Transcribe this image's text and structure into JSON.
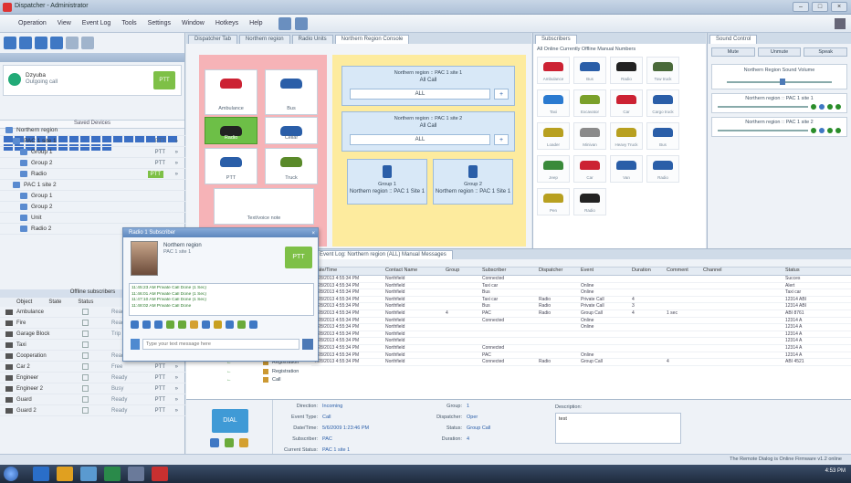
{
  "window": {
    "title": "Dispatcher - Administrator"
  },
  "menu": {
    "items": [
      "Operation",
      "View",
      "Event Log",
      "Tools",
      "Settings",
      "Window",
      "Hotkeys",
      "Help"
    ]
  },
  "left": {
    "account": {
      "name": "Dzyuba",
      "status": "Outgoing call",
      "ptt": "PTT"
    },
    "stub_label": "Saved Devices",
    "tree": [
      {
        "label": "Northern region",
        "level": 0,
        "ptt": "",
        "hi": false
      },
      {
        "label": "PAC 1 site 1",
        "level": 1,
        "ptt": "PTT",
        "hi": false
      },
      {
        "label": "Group 1",
        "level": 2,
        "ptt": "PTT",
        "hi": false
      },
      {
        "label": "Group 2",
        "level": 2,
        "ptt": "PTT",
        "hi": false
      },
      {
        "label": "Radio",
        "level": 2,
        "ptt": "PTT",
        "hi": true
      },
      {
        "label": "PAC 1 site 2",
        "level": 1,
        "ptt": "",
        "hi": false
      },
      {
        "label": "Group 1",
        "level": 2,
        "ptt": "",
        "hi": false
      },
      {
        "label": "Group 2",
        "level": 2,
        "ptt": "",
        "hi": false
      },
      {
        "label": "Unit",
        "level": 2,
        "ptt": "",
        "hi": false
      },
      {
        "label": "Radio 2",
        "level": 2,
        "ptt": "",
        "hi": false
      }
    ],
    "subhdr": "Offline subscribers",
    "columns": [
      "Object",
      "State",
      "Status"
    ],
    "rows": [
      {
        "name": "Ambulance",
        "status": "Ready",
        "ptt": "PTT"
      },
      {
        "name": "Fire",
        "status": "Ready",
        "ptt": "PTT"
      },
      {
        "name": "Garage Block",
        "status": "Trip",
        "ptt": "PTT"
      },
      {
        "name": "Taxi",
        "status": "",
        "ptt": "PTT"
      },
      {
        "name": "Cooperation",
        "status": "Ready",
        "ptt": "PTT"
      },
      {
        "name": "Car 2",
        "status": "Free",
        "ptt": "PTT"
      },
      {
        "name": "Engineer",
        "status": "Ready",
        "ptt": "PTT"
      },
      {
        "name": "Engineer 2",
        "status": "Busy",
        "ptt": "PTT"
      },
      {
        "name": "Guard",
        "status": "Ready",
        "ptt": "PTT"
      },
      {
        "name": "Guard 2",
        "status": "Ready",
        "ptt": "PTT"
      }
    ],
    "footer": "All Statuses"
  },
  "center": {
    "tabs": [
      "Dispatcher Tab",
      "Northern region",
      "Radio Units",
      "Northern Region Console"
    ],
    "pink_tiles": [
      {
        "label": "Ambulance",
        "color": "#cc2233",
        "sel": false
      },
      {
        "label": "Bus",
        "color": "#2a5ea8",
        "sel": false
      },
      {
        "label": "Radio",
        "color": "#222222",
        "sel": true
      },
      {
        "label": "Cellar",
        "color": "#2a5ea8",
        "sel": false
      },
      {
        "label": "PTT",
        "color": "#2a5ea8",
        "sel": false
      },
      {
        "label": "Truck",
        "color": "#5a8a2a",
        "sel": false
      }
    ],
    "cards": [
      {
        "h1": "Northern region :: PAC 1 site 1",
        "h2": "All Call",
        "bar": "ALL"
      },
      {
        "h1": "Northern region :: PAC 1 site 2",
        "h2": "All Call",
        "bar": "ALL"
      }
    ],
    "small_cards": [
      {
        "h1": "Group 1",
        "h2": "Northern region :: PAC 1 Site 1"
      },
      {
        "h1": "Group 2",
        "h2": "Northern region :: PAC 1 Site 1"
      }
    ],
    "note_input": "Text/voice note"
  },
  "right": {
    "tab": "Subscribers",
    "filters": "All   Online   Currently Offline   Manual Numbers",
    "icons": [
      {
        "label": "Ambulance",
        "color": "#cc2233"
      },
      {
        "label": "Bus",
        "color": "#2a5ea8"
      },
      {
        "label": "Radio",
        "color": "#222222"
      },
      {
        "label": "Tow truck",
        "color": "#4a6a3a"
      },
      {
        "label": "Taxi",
        "color": "#2a7ad0"
      },
      {
        "label": "Excavator",
        "color": "#7aa02a"
      },
      {
        "label": "Car",
        "color": "#cc2233"
      },
      {
        "label": "Cargo truck",
        "color": "#2a5ea8"
      },
      {
        "label": "Loader",
        "color": "#b8a020"
      },
      {
        "label": "Minivan",
        "color": "#8a8a8a"
      },
      {
        "label": "Heavy Truck",
        "color": "#b8a020"
      },
      {
        "label": "Bus",
        "color": "#2a5ea8"
      },
      {
        "label": "Jeep",
        "color": "#3a8a3a"
      },
      {
        "label": "Car",
        "color": "#cc2233"
      },
      {
        "label": "Van",
        "color": "#2a5ea8"
      },
      {
        "label": "Radio",
        "color": "#2a5ea8"
      },
      {
        "label": "Pen",
        "color": "#b8a020"
      },
      {
        "label": "Radio",
        "color": "#222222"
      }
    ]
  },
  "farright": {
    "tab": "Sound Control",
    "buttons": [
      "Mute",
      "Unmute",
      "Speak"
    ],
    "volume_title": "Northern Region Sound Volume",
    "groups": [
      "Northern region :: PAC 1 site 1",
      "Northern region :: PAC 1 site 2"
    ]
  },
  "log": {
    "tab": "Event Log: Northern region (ALL) Manual Messages",
    "columns": [
      "Date/Time",
      "Contact Name",
      "Group",
      "Subscriber",
      "Dispatcher",
      "Event",
      "Duration",
      "Comment",
      "Channel",
      "Status"
    ],
    "rows": [
      [
        "7/28/2013 4:55:34 PM",
        "Northfield",
        "",
        "Connected",
        "",
        "",
        "",
        "",
        "",
        "Succes"
      ],
      [
        "7/28/2013 4:55:34 PM",
        "Northfield",
        "",
        "Taxi car",
        "",
        "Online",
        "",
        "",
        "",
        "Alert"
      ],
      [
        "7/28/2013 4:55:34 PM",
        "Northfield",
        "",
        "Bus",
        "",
        "Online",
        "",
        "",
        "",
        "Taxi car"
      ],
      [
        "7/28/2013 4:55:34 PM",
        "Northfield",
        "",
        "Taxi car",
        "Radio",
        "Private Call",
        "4",
        "",
        "",
        "12314 ABI"
      ],
      [
        "7/28/2013 4:55:34 PM",
        "Northfield",
        "",
        "Bus",
        "Radio",
        "Private Call",
        "3",
        "",
        "",
        "12314 ABI"
      ],
      [
        "7/28/2013 4:55:34 PM",
        "Northfield",
        "4",
        "PAC",
        "Radio",
        "Group Call",
        "4",
        "1 sec",
        "",
        "ABI 8761"
      ],
      [
        "7/28/2013 4:55:34 PM",
        "Northfield",
        "",
        "Connected",
        "",
        "Online",
        "",
        "",
        "",
        "12314 A"
      ],
      [
        "7/28/2013 4:55:34 PM",
        "Northfield",
        "",
        "",
        "",
        "Online",
        "",
        "",
        "",
        "12314 A"
      ],
      [
        "7/28/2013 4:55:34 PM",
        "Northfield",
        "",
        "",
        "",
        "",
        "",
        "",
        "",
        "12314 A"
      ],
      [
        "7/28/2013 4:55:34 PM",
        "Northfield",
        "",
        "",
        "",
        "",
        "",
        "",
        "",
        "12314 A"
      ],
      [
        "7/28/2013 4:55:34 PM",
        "Northfield",
        "",
        "Connected",
        "",
        "",
        "",
        "",
        "",
        "12314 A"
      ],
      [
        "7/28/2013 4:55:34 PM",
        "Northfield",
        "",
        "PAC",
        "",
        "Online",
        "",
        "",
        "",
        "12314 A"
      ],
      [
        "7/28/2013 4:55:34 PM",
        "Northfield",
        "",
        "Connected",
        "Radio",
        "Group Call",
        "",
        "4",
        "",
        "ABI 4521"
      ]
    ],
    "left_rows": [
      "Registration",
      "Registration",
      "Registration",
      "Registration",
      "Registration",
      "Call"
    ]
  },
  "detail": {
    "big_button": "DIAL",
    "fields": [
      {
        "k": "Direction:",
        "v": "Incoming"
      },
      {
        "k": "Event Type:",
        "v": "Call"
      },
      {
        "k": "Date/Time:",
        "v": "5/6/2009 1:23:46 PM"
      },
      {
        "k": "Subscriber:",
        "v": "PAC"
      },
      {
        "k": "Current Status:",
        "v": "PAC 1 site 1"
      }
    ],
    "fields2": [
      {
        "k": "Group:",
        "v": "1"
      },
      {
        "k": "Dispatcher:",
        "v": "Oper"
      },
      {
        "k": "Status:",
        "v": "Group Call"
      },
      {
        "k": "Duration:",
        "v": "4"
      }
    ],
    "desc_label": "Description:",
    "desc_value": "test"
  },
  "status": {
    "text": "The Remote Dialog is   Online   Firmware v1.2 online"
  },
  "popup": {
    "title": "Radio 1 Subscriber",
    "name": "Northern region",
    "sub": "PAC 1 site 1",
    "ptt": "PTT",
    "messages": [
      "11:45:23 AM Private Call Done (1 Sec)",
      "11:46:01 AM Private Call Done (1 Sec)",
      "11:47:10 AM Private Call Done (1 Sec)",
      "11:48:02 AM Private Call Done"
    ],
    "input_placeholder": "Type your text message here"
  },
  "taskbar": {
    "time": "4:53 PM"
  }
}
